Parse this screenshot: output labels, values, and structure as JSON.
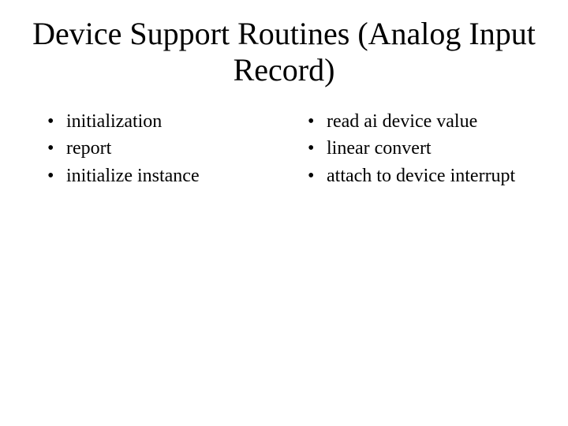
{
  "title": "Device Support Routines (Analog Input Record)",
  "left": {
    "items": [
      "initialization",
      "report",
      "initialize instance"
    ]
  },
  "right": {
    "items": [
      "read ai device value",
      "linear convert",
      "attach to device interrupt"
    ]
  }
}
